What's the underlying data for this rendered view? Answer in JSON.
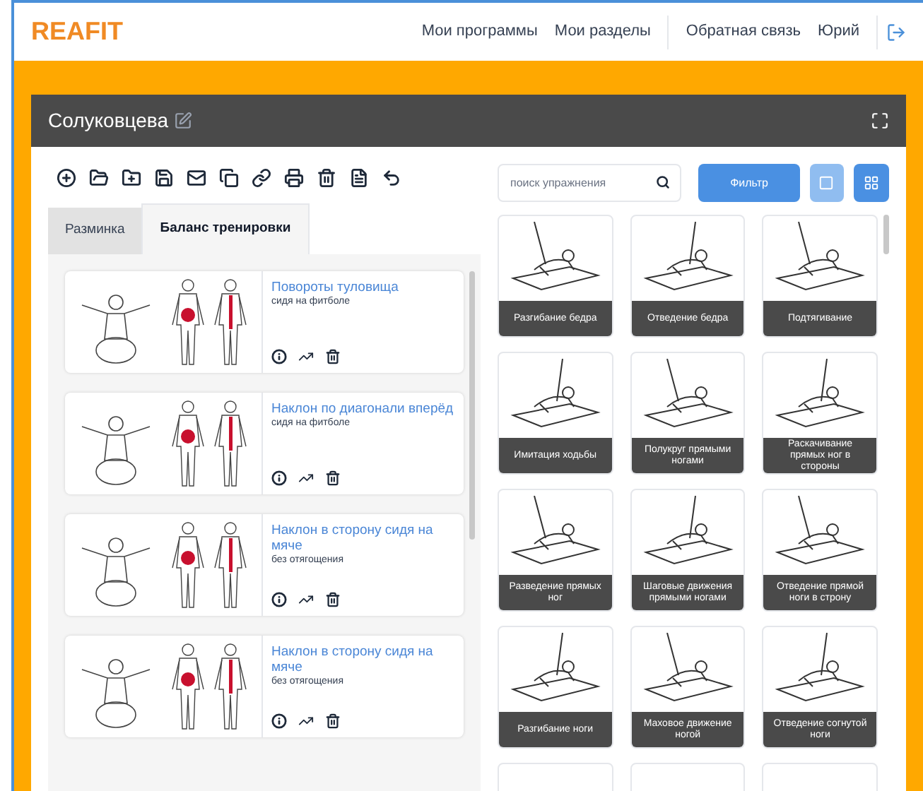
{
  "header": {
    "logo": "REAFIT",
    "nav": [
      "Мои программы",
      "Мои разделы",
      "Обратная связь",
      "Юрий"
    ]
  },
  "panel": {
    "title": "Солуковцева"
  },
  "tabs": [
    {
      "label": "Разминка",
      "selected": false
    },
    {
      "label": "Баланс тренировки",
      "selected": true
    }
  ],
  "program_exercises": [
    {
      "title": "Повороты туловища",
      "subtitle": "сидя на фитболе"
    },
    {
      "title": "Наклон по диагонали вперёд",
      "subtitle": "сидя на фитболе"
    },
    {
      "title": "Наклон в сторону сидя на мяче",
      "subtitle": "без отягощения"
    },
    {
      "title": "Наклон в сторону сидя на мяче",
      "subtitle": "без отягощения"
    }
  ],
  "search": {
    "placeholder": "поиск упражнения"
  },
  "filter_button": "Фильтр",
  "view_modes": [
    {
      "kind": "single",
      "selected": false
    },
    {
      "kind": "grid",
      "selected": true
    }
  ],
  "catalog": [
    {
      "name": "Разгибание бедра"
    },
    {
      "name": "Отведение бедра"
    },
    {
      "name": "Подтягивание"
    },
    {
      "name": "Имитация ходьбы"
    },
    {
      "name": "Полукруг прямыми ногами"
    },
    {
      "name": "Раскачивание прямых ног в стороны"
    },
    {
      "name": "Разведение прямых ног"
    },
    {
      "name": "Шаговые движения прямыми ногами"
    },
    {
      "name": "Отведение прямой ноги в строну"
    },
    {
      "name": "Разгибание ноги"
    },
    {
      "name": "Маховое движение ногой"
    },
    {
      "name": "Отведение согнутой ноги"
    }
  ]
}
